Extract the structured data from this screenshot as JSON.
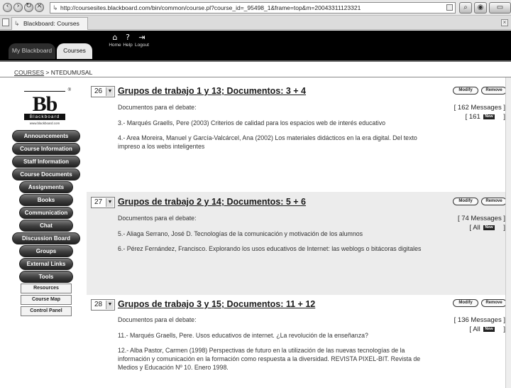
{
  "browser": {
    "url": "http://coursesites.blackboard.com/bin/common/course.pl?course_id=_95498_1&frame=top&m=20043311123321",
    "tab_title": "Blackboard: Courses",
    "nav_icons": [
      "back-icon",
      "forward-icon",
      "reload-icon",
      "stop-icon"
    ]
  },
  "header": {
    "tabs": [
      {
        "label": "My Blackboard"
      },
      {
        "label": "Courses"
      }
    ],
    "topnav": [
      {
        "label": "Home",
        "icon": "home-icon"
      },
      {
        "label": "Help",
        "icon": "help-icon"
      },
      {
        "label": "Logout",
        "icon": "logout-icon"
      }
    ]
  },
  "breadcrumb": {
    "root": "COURSES",
    "separator": ">",
    "current": "NTEDUMUSAL"
  },
  "logo": {
    "mark": "Bb",
    "reg": "®",
    "wordmark": "Blackboard",
    "url": "www.blackboard.com"
  },
  "menu": {
    "items": [
      "Announcements",
      "Course Information",
      "Staff Information",
      "Course Documents",
      "Assignments",
      "Books",
      "Communication",
      "Chat",
      "Discussion Board",
      "Groups",
      "External Links",
      "Tools"
    ],
    "secondary": [
      "Resources",
      "Course Map",
      "Control Panel"
    ]
  },
  "forums": [
    {
      "order": "26",
      "title": "Grupos de trabajo 1 y 13; Documentos: 3 + 4",
      "intro": "Documentos para el debate:",
      "paragraphs": [
        "3.- Marqués Graells, Pere (2003) Criterios de calidad para los espacios web de interés educativo",
        "4.- Area Moreira, Manuel y García-Valcárcel, Ana (2002) Los materiales didácticos en la era digital. Del texto impreso a los webs inteligentes"
      ],
      "messages": "[ 162 Messages ]",
      "new_prefix": "[ 161",
      "new_suffix": "]",
      "shaded": false
    },
    {
      "order": "27",
      "title": "Grupos de trabajo 2 y 14; Documentos: 5 + 6",
      "intro": "Documentos para el debate:",
      "paragraphs": [
        "5.- Aliaga Serrano, José D. Tecnologías de la comunicación y motivación de los alumnos",
        "6.- Pérez Fernández, Francisco. Explorando los usos educativos de Internet: las weblogs o bitácoras digitales"
      ],
      "messages": "[ 74 Messages ]",
      "new_prefix": "[ All",
      "new_suffix": "]",
      "shaded": true
    },
    {
      "order": "28",
      "title": "Grupos de trabajo 3 y 15; Documentos: 11 + 12",
      "intro": "Documentos para el debate:",
      "paragraphs": [
        "11.- Marqués Graells, Pere. Usos educativos de internet. ¿La revolución de la enseñanza?",
        "12.- Alba Pastor, Carmen (1998) Perspectivas de futuro en la utilización de las nuevas tecnologías de la información y comunicación en la formación como respuesta a la diversidad. REVISTA PIXEL-BIT. Revista de Medios y Educación Nº 10. Enero 1998."
      ],
      "messages": "[ 136 Messages ]",
      "new_prefix": "[ All",
      "new_suffix": "]",
      "shaded": false
    }
  ],
  "labels": {
    "modify": "Modify",
    "remove": "Remove",
    "new_badge": "New"
  }
}
